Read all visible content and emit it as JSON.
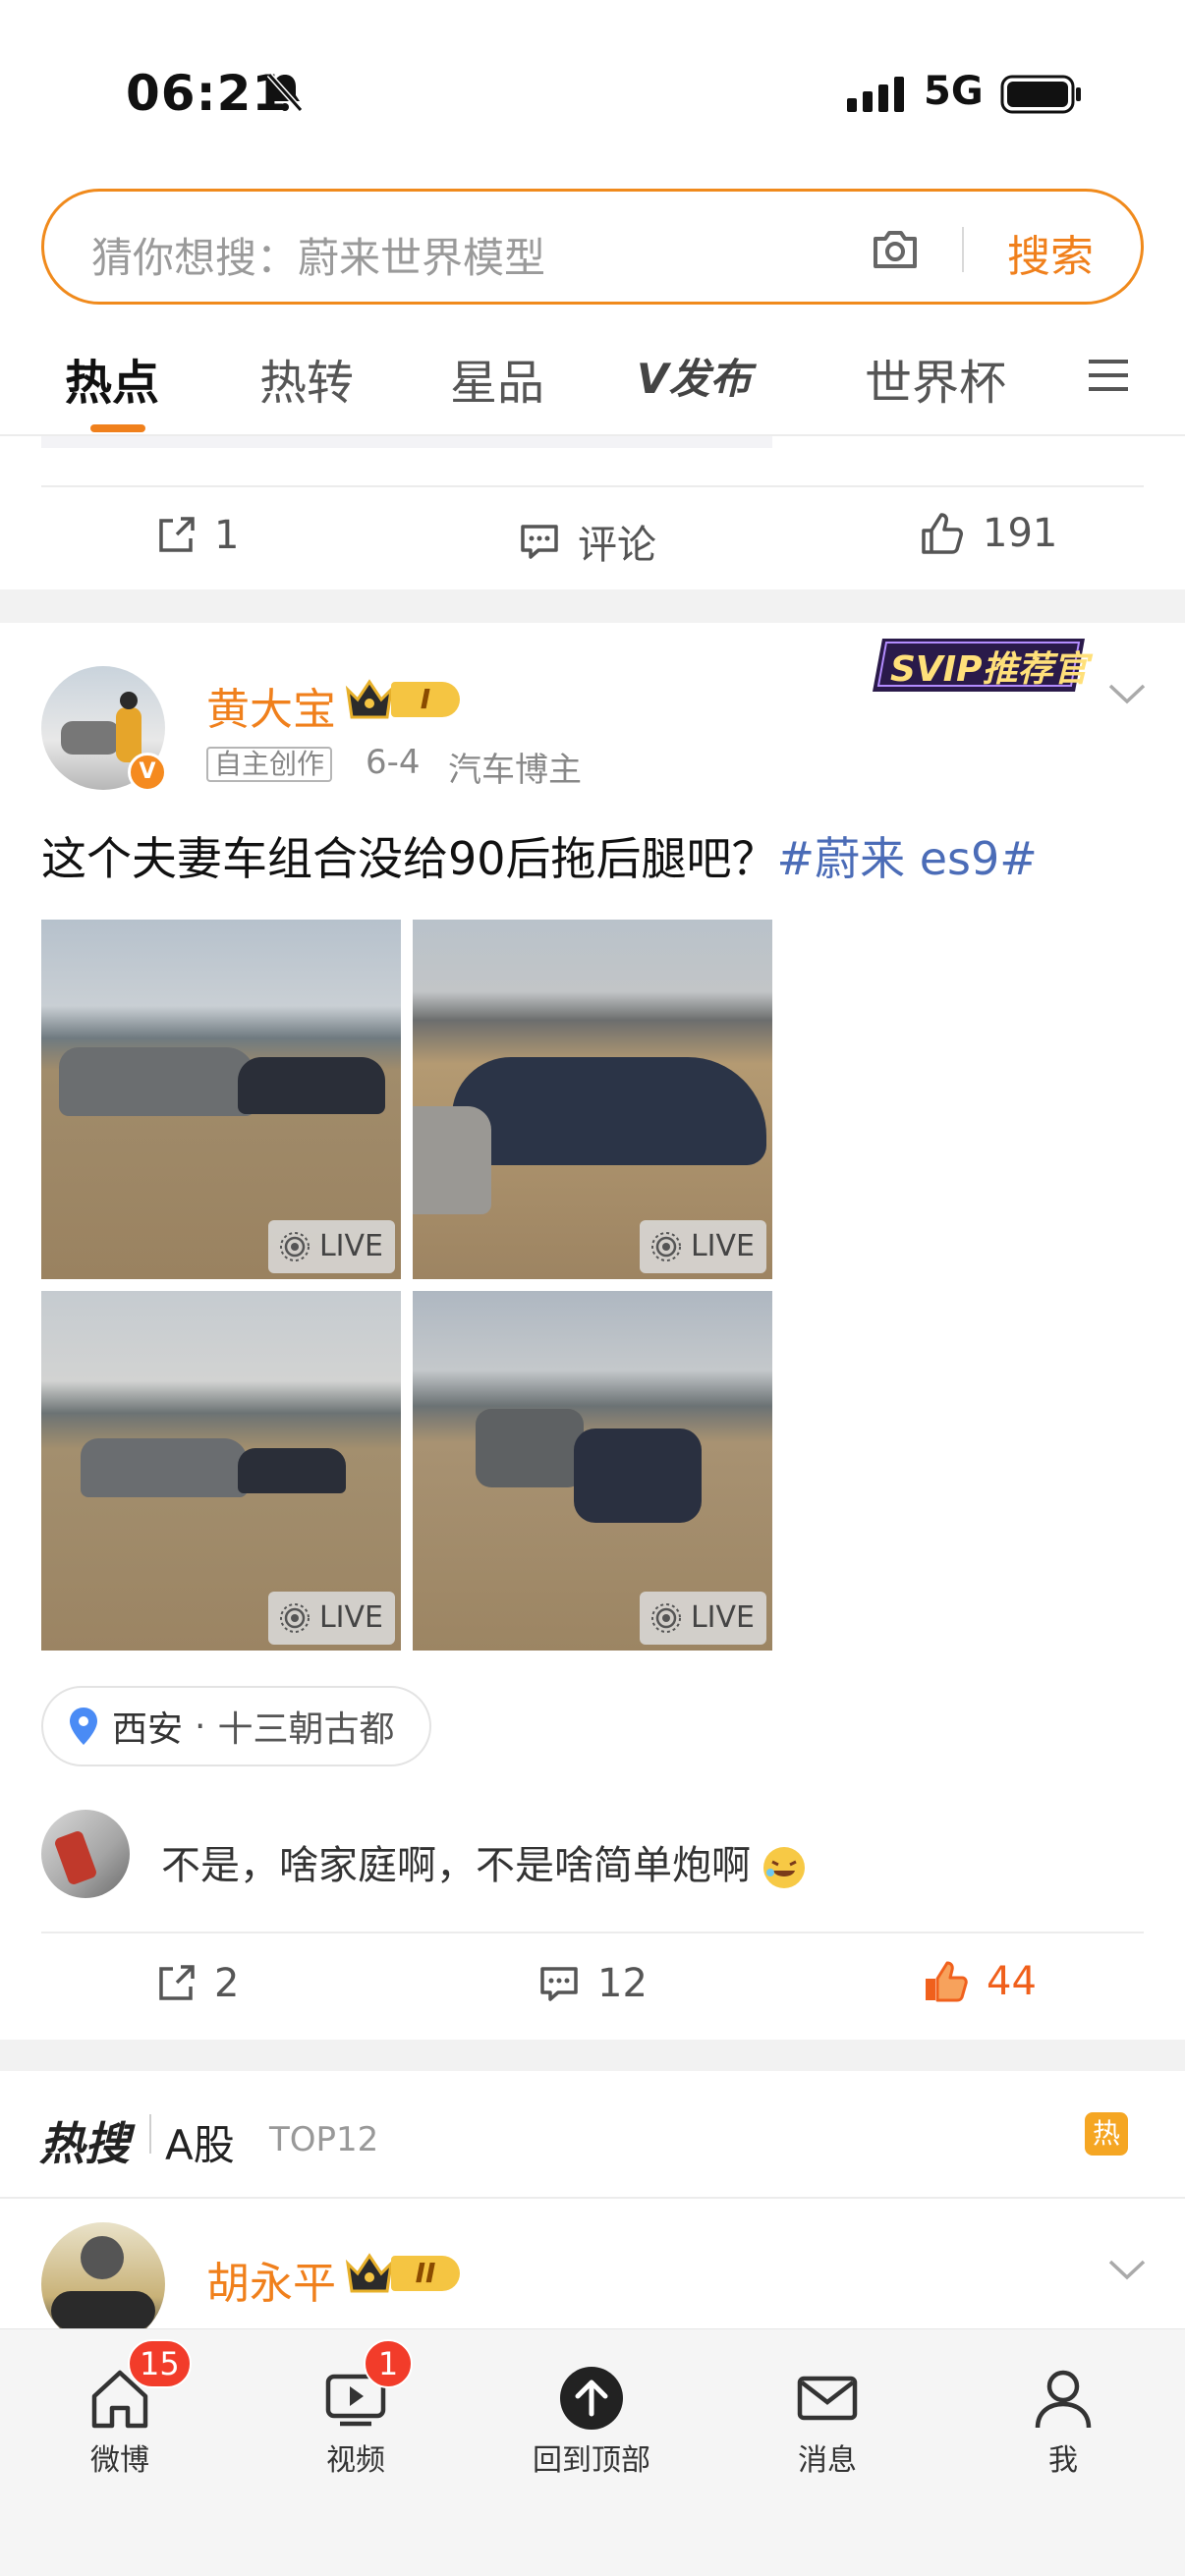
{
  "status": {
    "time": "06:21",
    "network": "5G"
  },
  "search": {
    "placeholder": "猜你想搜：蔚来世界模型",
    "button": "搜索"
  },
  "tabs": [
    {
      "label": "热点",
      "active": true
    },
    {
      "label": "热转"
    },
    {
      "label": "星品"
    },
    {
      "label": "发布"
    },
    {
      "label": "世界杯"
    }
  ],
  "prev_post": {
    "repost_count": "1",
    "comment_label": "评论",
    "like_count": "191"
  },
  "post": {
    "author": "黄大宝",
    "level": "I",
    "tag": "自主创作",
    "date": "6-4",
    "role": "汽车博主",
    "svip_badge": "SVIP推荐官",
    "text": "这个夫妻车组合没给90后拖后腿吧？",
    "hashtag": "#蔚来 es9#",
    "photos": [
      {
        "label": "LIVE",
        "scene": "two cars side view"
      },
      {
        "label": "LIVE",
        "scene": "bentley close"
      },
      {
        "label": "LIVE",
        "scene": "two cars far"
      },
      {
        "label": "LIVE",
        "scene": "two cars front"
      }
    ],
    "location": {
      "city": "西安",
      "sep": "·",
      "name": "十三朝古都"
    },
    "top_comment": "不是，啥家庭啊，不是啥简单炮啊",
    "repost_count": "2",
    "comment_count": "12",
    "like_count": "44"
  },
  "hot": {
    "logo": "热搜",
    "topic": "A股",
    "rank": "TOP12",
    "badge": "热"
  },
  "next_post": {
    "author": "胡永平",
    "level": "II"
  },
  "bottom_nav": [
    {
      "label": "微博",
      "badge": "15"
    },
    {
      "label": "视频",
      "badge": "1"
    },
    {
      "label": "回到顶部"
    },
    {
      "label": "消息"
    },
    {
      "label": "我"
    }
  ],
  "colors": {
    "accent": "#f0801c",
    "link": "#4b6cb7",
    "badge_red": "#f23c2a"
  }
}
